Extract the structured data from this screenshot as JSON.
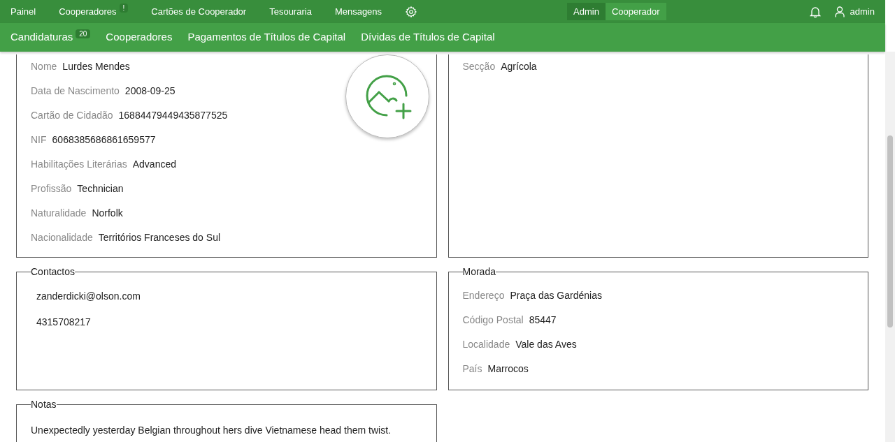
{
  "top_nav": {
    "items": [
      {
        "label": "Painel"
      },
      {
        "label": "Cooperadores",
        "badge": "!"
      },
      {
        "label": "Cartões de Cooperador"
      },
      {
        "label": "Tesouraria"
      },
      {
        "label": "Mensagens"
      }
    ],
    "role_toggle": [
      {
        "label": "Admin",
        "selected": true
      },
      {
        "label": "Cooperador",
        "selected": false
      }
    ],
    "user": "admin"
  },
  "sub_nav": {
    "items": [
      {
        "label": "Candidaturas",
        "badge": "20"
      },
      {
        "label": "Cooperadores"
      },
      {
        "label": "Pagamentos de Títulos de Capital"
      },
      {
        "label": "Dívidas de Títulos de Capital"
      }
    ]
  },
  "panels": [
    {
      "kind": "fields",
      "photo_button": true,
      "fields": [
        {
          "label": "Nome",
          "value": "Lurdes Mendes"
        },
        {
          "label": "Data de Nascimento",
          "value": "2008-09-25"
        },
        {
          "label": "Cartão de Cidadão",
          "value": "16884479449435877525"
        },
        {
          "label": "NIF",
          "value": "6068385686861659577"
        },
        {
          "label": "Habilitações Literárias",
          "value": "Advanced"
        },
        {
          "label": "Profissão",
          "value": "Technician"
        },
        {
          "label": "Naturalidade",
          "value": "Norfolk"
        },
        {
          "label": "Nacionalidade",
          "value": "Territórios Franceses do Sul"
        }
      ]
    },
    {
      "kind": "fields",
      "fields": [
        {
          "label": "Secção",
          "value": "Agrícola"
        }
      ]
    },
    {
      "kind": "contacts",
      "legend": "Contactos",
      "items": [
        "zanderdicki@olson.com",
        "4315708217"
      ]
    },
    {
      "kind": "fields",
      "legend": "Morada",
      "fields": [
        {
          "label": "Endereço",
          "value": "Praça das Gardénias"
        },
        {
          "label": "Código Postal",
          "value": "85447"
        },
        {
          "label": "Localidade",
          "value": "Vale das Aves"
        },
        {
          "label": "País",
          "value": "Marrocos"
        }
      ]
    },
    {
      "kind": "notes",
      "legend": "Notas",
      "text": "Unexpectedly yesterday Belgian throughout hers dive Vietnamese head them twist."
    }
  ]
}
